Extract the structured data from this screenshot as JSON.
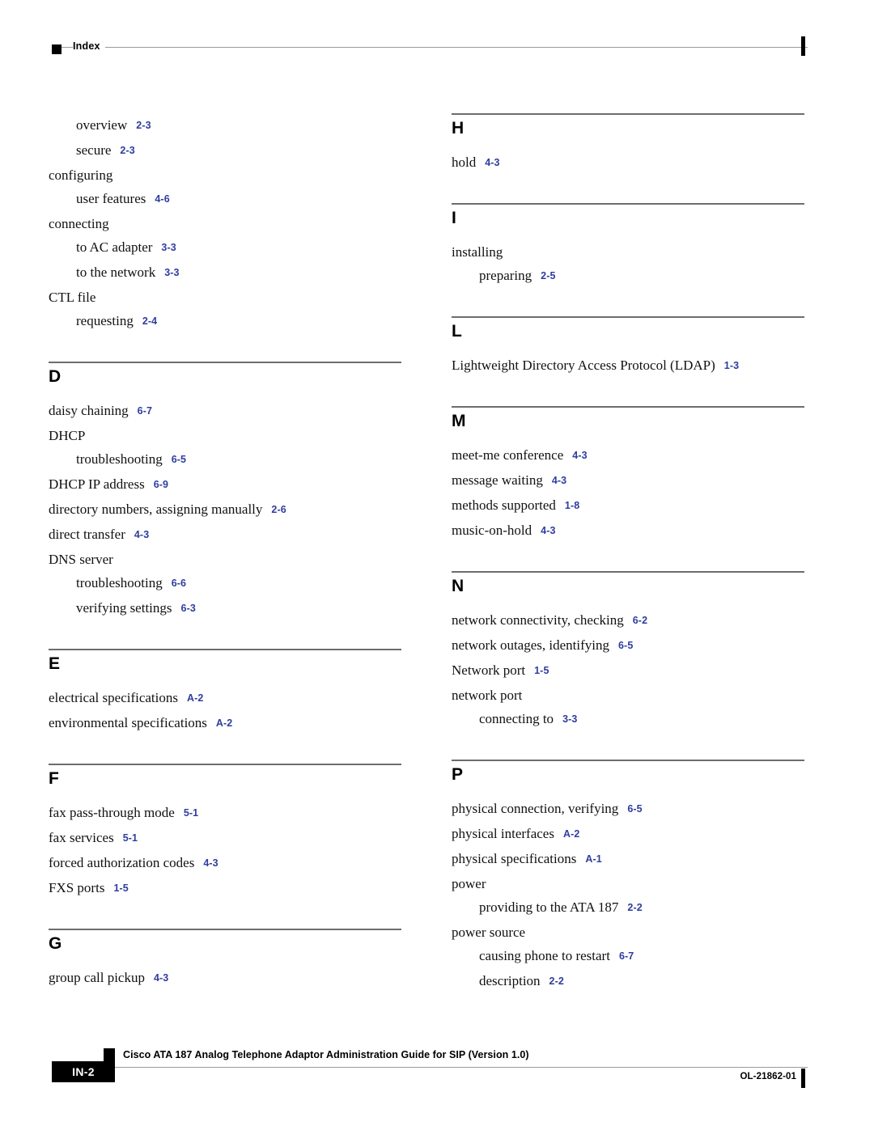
{
  "header": {
    "title": "Index",
    "marker_icon": "black-square-icon"
  },
  "columns": {
    "left": [
      {
        "letter": "",
        "has_rule": false,
        "entries": [
          {
            "level": 2,
            "term": "overview",
            "ref": "2-3"
          },
          {
            "level": 2,
            "term": "secure",
            "ref": "2-3"
          },
          {
            "level": 1,
            "term": "configuring",
            "ref": ""
          },
          {
            "level": 2,
            "term": "user features",
            "ref": "4-6"
          },
          {
            "level": 1,
            "term": "connecting",
            "ref": ""
          },
          {
            "level": 2,
            "term": "to AC adapter",
            "ref": "3-3"
          },
          {
            "level": 2,
            "term": "to the network",
            "ref": "3-3"
          },
          {
            "level": 1,
            "term": "CTL file",
            "ref": ""
          },
          {
            "level": 2,
            "term": "requesting",
            "ref": "2-4"
          }
        ]
      },
      {
        "letter": "D",
        "has_rule": true,
        "entries": [
          {
            "level": 1,
            "term": "daisy chaining",
            "ref": "6-7"
          },
          {
            "level": 1,
            "term": "DHCP",
            "ref": ""
          },
          {
            "level": 2,
            "term": "troubleshooting",
            "ref": "6-5"
          },
          {
            "level": 1,
            "term": "DHCP IP address",
            "ref": "6-9"
          },
          {
            "level": 1,
            "term": "directory numbers, assigning manually",
            "ref": "2-6"
          },
          {
            "level": 1,
            "term": "direct transfer",
            "ref": "4-3"
          },
          {
            "level": 1,
            "term": "DNS server",
            "ref": ""
          },
          {
            "level": 2,
            "term": "troubleshooting",
            "ref": "6-6"
          },
          {
            "level": 2,
            "term": "verifying settings",
            "ref": "6-3"
          }
        ]
      },
      {
        "letter": "E",
        "has_rule": true,
        "entries": [
          {
            "level": 1,
            "term": "electrical specifications",
            "ref": "A-2"
          },
          {
            "level": 1,
            "term": "environmental specifications",
            "ref": "A-2"
          }
        ]
      },
      {
        "letter": "F",
        "has_rule": true,
        "entries": [
          {
            "level": 1,
            "term": "fax pass-through mode",
            "ref": "5-1"
          },
          {
            "level": 1,
            "term": "fax services",
            "ref": "5-1"
          },
          {
            "level": 1,
            "term": "forced authorization codes",
            "ref": "4-3"
          },
          {
            "level": 1,
            "term": "FXS ports",
            "ref": "1-5"
          }
        ]
      },
      {
        "letter": "G",
        "has_rule": true,
        "entries": [
          {
            "level": 1,
            "term": "group call pickup",
            "ref": "4-3"
          }
        ]
      }
    ],
    "right": [
      {
        "letter": "H",
        "has_rule": true,
        "entries": [
          {
            "level": 1,
            "term": "hold",
            "ref": "4-3"
          }
        ]
      },
      {
        "letter": "I",
        "has_rule": true,
        "entries": [
          {
            "level": 1,
            "term": "installing",
            "ref": ""
          },
          {
            "level": 2,
            "term": "preparing",
            "ref": "2-5"
          }
        ]
      },
      {
        "letter": "L",
        "has_rule": true,
        "entries": [
          {
            "level": 1,
            "term": "Lightweight Directory Access Protocol (LDAP)",
            "ref": "1-3"
          }
        ]
      },
      {
        "letter": "M",
        "has_rule": true,
        "entries": [
          {
            "level": 1,
            "term": "meet-me conference",
            "ref": "4-3"
          },
          {
            "level": 1,
            "term": "message waiting",
            "ref": "4-3"
          },
          {
            "level": 1,
            "term": "methods supported",
            "ref": "1-8"
          },
          {
            "level": 1,
            "term": "music-on-hold",
            "ref": "4-3"
          }
        ]
      },
      {
        "letter": "N",
        "has_rule": true,
        "entries": [
          {
            "level": 1,
            "term": "network connectivity, checking",
            "ref": "6-2"
          },
          {
            "level": 1,
            "term": "network outages, identifying",
            "ref": "6-5"
          },
          {
            "level": 1,
            "term": "Network port",
            "ref": "1-5"
          },
          {
            "level": 1,
            "term": "network port",
            "ref": ""
          },
          {
            "level": 2,
            "term": "connecting to",
            "ref": "3-3"
          }
        ]
      },
      {
        "letter": "P",
        "has_rule": true,
        "entries": [
          {
            "level": 1,
            "term": "physical connection, verifying",
            "ref": "6-5"
          },
          {
            "level": 1,
            "term": "physical interfaces",
            "ref": "A-2"
          },
          {
            "level": 1,
            "term": "physical specifications",
            "ref": "A-1"
          },
          {
            "level": 1,
            "term": "power",
            "ref": ""
          },
          {
            "level": 2,
            "term": "providing to the ATA 187",
            "ref": "2-2"
          },
          {
            "level": 1,
            "term": "power source",
            "ref": ""
          },
          {
            "level": 2,
            "term": "causing phone to restart",
            "ref": "6-7"
          },
          {
            "level": 2,
            "term": "description",
            "ref": "2-2"
          }
        ]
      }
    ]
  },
  "footer": {
    "document_title": "Cisco ATA 187 Analog Telephone Adaptor Administration Guide for SIP (Version 1.0)",
    "page_number": "IN-2",
    "doc_number": "OL-21862-01",
    "marker_icon": "black-square-icon"
  },
  "colors": {
    "reference_blue": "#2e3d9e",
    "rule_gray": "#6d6d6d",
    "text_black": "#111111"
  }
}
